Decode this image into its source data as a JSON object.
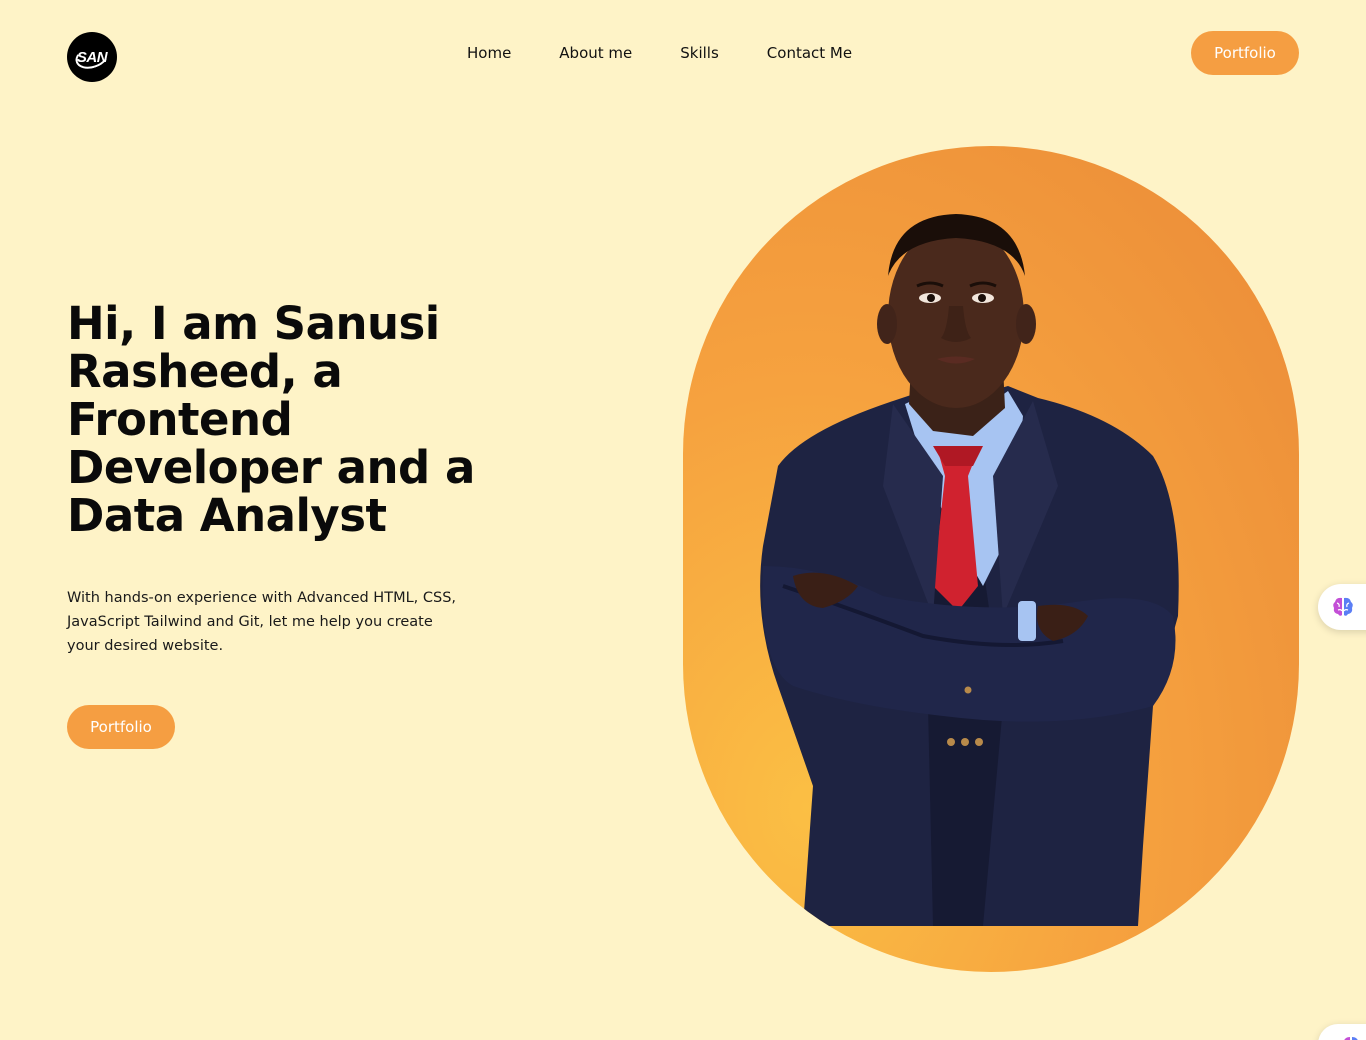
{
  "header": {
    "logo_text": "SAN",
    "nav": [
      "Home",
      "About me",
      "Skills",
      "Contact Me"
    ],
    "cta_label": "Portfolio"
  },
  "hero": {
    "title": "Hi, I am Sanusi Rasheed, a Frontend Developer and a Data Analyst",
    "description": "With hands-on experience with Advanced HTML, CSS, JavaScript Tailwind and Git, let me help you create your desired website.",
    "cta_label": "Portfolio"
  },
  "colors": {
    "background": "#fef3c7",
    "accent": "#f59e42",
    "text": "#0a0a0a"
  },
  "icons": {
    "widget": "brain-icon"
  }
}
